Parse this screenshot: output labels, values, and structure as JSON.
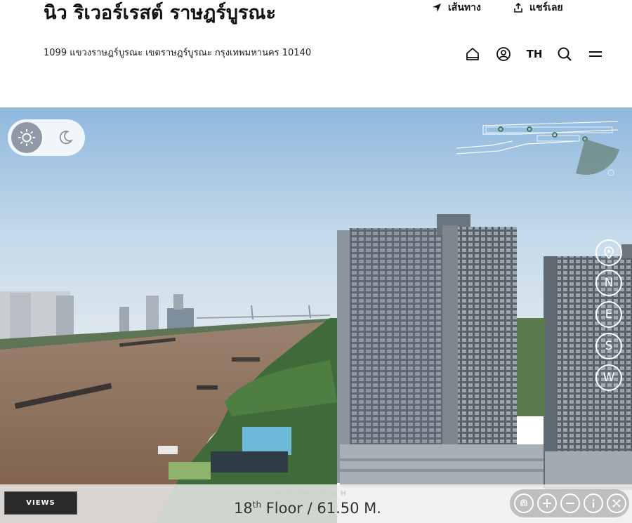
{
  "header": {
    "title": "นิว ริเวอร์เรสต์ ราษฎร์บูรณะ",
    "address": "1099 แขวงราษฎร์บูรณะ เขตราษฎร์บูรณะ กรุงเทพมหานคร 10140",
    "directions_label": "เส้นทาง",
    "share_label": "แชร์เลย",
    "language": "TH",
    "icons": [
      "home-icon",
      "user-icon",
      "search-icon",
      "menu-icon"
    ]
  },
  "viewer": {
    "day_night": {
      "selected": "day",
      "options": [
        "sun-icon",
        "moon-icon"
      ]
    },
    "compass": [
      "N",
      "E",
      "S",
      "W"
    ],
    "views_label": "VIEWS",
    "building_label": "BUILDING G & H",
    "floor_number": "18",
    "floor_suffix": "th",
    "floor_text": " Floor / 61.50 M.",
    "controls": [
      "gyro-icon",
      "zoom-in-icon",
      "zoom-out-icon",
      "info-icon",
      "fullscreen-icon"
    ]
  },
  "colors": {
    "sky_top": "#9fc3e2",
    "river": "#8a6a52",
    "building": "#6f7880",
    "accent_day": "#8f9aa6"
  }
}
